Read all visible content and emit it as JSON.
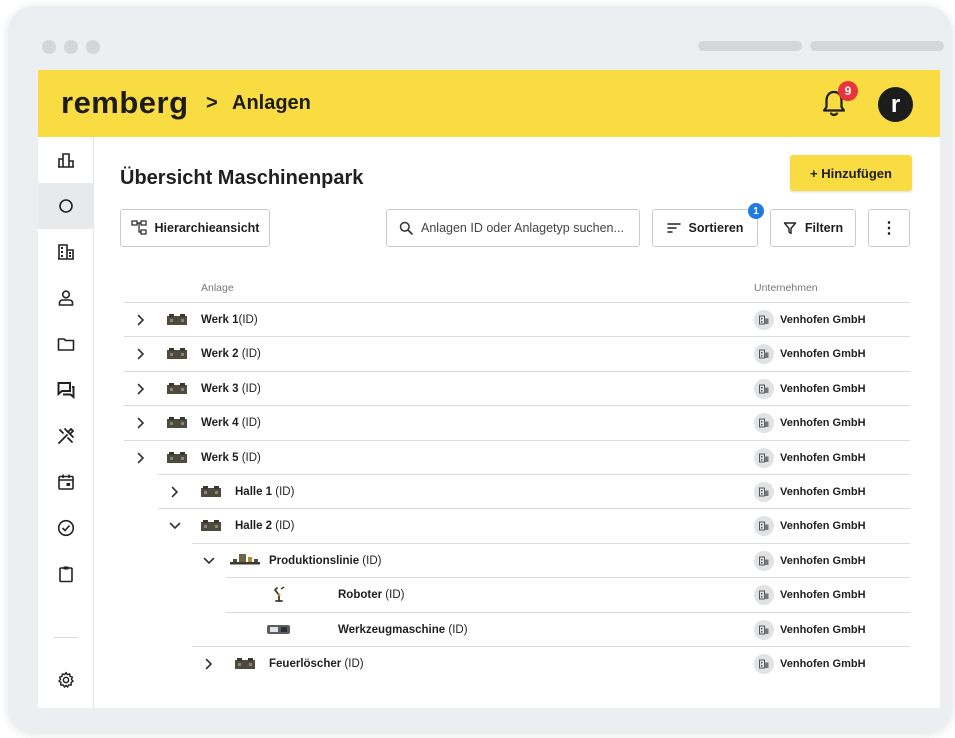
{
  "app": {
    "logo": "remberg",
    "breadcrumb_separator": ">",
    "breadcrumb": "Anlagen",
    "notification_count": "9",
    "avatar_letter": "r",
    "brand_color": "#f9dc41"
  },
  "sidebar": {
    "items": [
      {
        "icon": "dashboard-icon"
      },
      {
        "icon": "assets-circle-icon",
        "active": true
      },
      {
        "icon": "building-icon"
      },
      {
        "icon": "contacts-icon"
      },
      {
        "icon": "folder-icon"
      },
      {
        "icon": "tickets-chat-icon"
      },
      {
        "icon": "tools-icon"
      },
      {
        "icon": "calendar-icon"
      },
      {
        "icon": "checkmark-circle-icon"
      },
      {
        "icon": "clipboard-icon"
      },
      {
        "icon": "settings-icon"
      }
    ]
  },
  "main": {
    "title": "Übersicht Maschinenpark",
    "add_button": "+ Hinzufügen",
    "hierarchy_button": "Hierarchieansicht",
    "search_placeholder": "Anlagen ID oder Anlagetyp suchen...",
    "sort_button": "Sortieren",
    "sort_badge": "1",
    "filter_button": "Filtern",
    "more_button": "⋮",
    "columns": {
      "asset": "Anlage",
      "company": "Unternehmen"
    }
  },
  "rows": [
    {
      "name": "Werk 1",
      "id": "(ID)",
      "company": "Venhofen GmbH",
      "level": 0,
      "expand": "collapsed",
      "icon": "factory-icon"
    },
    {
      "name": "Werk 2",
      "id": " (ID)",
      "company": "Venhofen GmbH",
      "level": 0,
      "expand": "collapsed",
      "icon": "factory-icon"
    },
    {
      "name": "Werk 3",
      "id": " (ID)",
      "company": "Venhofen GmbH",
      "level": 0,
      "expand": "collapsed",
      "icon": "factory-icon"
    },
    {
      "name": "Werk 4",
      "id": " (ID)",
      "company": "Venhofen GmbH",
      "level": 0,
      "expand": "collapsed",
      "icon": "factory-icon"
    },
    {
      "name": "Werk 5",
      "id": " (ID)",
      "company": "Venhofen GmbH",
      "level": 0,
      "expand": "collapsed",
      "icon": "factory-icon"
    },
    {
      "name": "Halle 1",
      "id": " (ID)",
      "company": "Venhofen GmbH",
      "level": 1,
      "expand": "collapsed",
      "icon": "factory-icon"
    },
    {
      "name": "Halle 2",
      "id": " (ID)",
      "company": "Venhofen GmbH",
      "level": 1,
      "expand": "expanded",
      "icon": "factory-icon"
    },
    {
      "name": "Produktionslinie",
      "id": " (ID)",
      "company": "Venhofen GmbH",
      "level": 2,
      "expand": "expanded",
      "icon": "production-line-icon"
    },
    {
      "name": "Roboter",
      "id": " (ID)",
      "company": "Venhofen GmbH",
      "level": 3,
      "expand": "none",
      "icon": "robot-arm-icon"
    },
    {
      "name": "Werkzeugmaschine",
      "id": " (ID)",
      "company": "Venhofen GmbH",
      "level": 3,
      "expand": "none",
      "icon": "machine-tool-icon"
    },
    {
      "name": "Feuerlöscher",
      "id": " (ID)",
      "company": "Venhofen GmbH",
      "level": 2,
      "expand": "collapsed",
      "icon": "factory-icon"
    }
  ]
}
